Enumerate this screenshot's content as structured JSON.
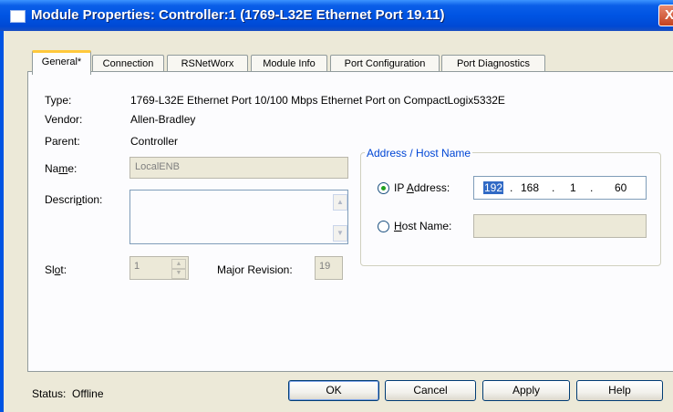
{
  "window": {
    "title": "Module Properties: Controller:1 (1769-L32E Ethernet Port 19.11)",
    "close_glyph": "X"
  },
  "tabs": [
    {
      "label": "General*"
    },
    {
      "label": "Connection"
    },
    {
      "label": "RSNetWorx"
    },
    {
      "label": "Module Info"
    },
    {
      "label": "Port Configuration"
    },
    {
      "label": "Port Diagnostics"
    }
  ],
  "general": {
    "type_label": "Type:",
    "type_value": "1769-L32E Ethernet Port 10/100 Mbps Ethernet Port on CompactLogix5332E",
    "vendor_label": "Vendor:",
    "vendor_value": "Allen-Bradley",
    "parent_label": "Parent:",
    "parent_value": "Controller",
    "name_label_pre": "Na",
    "name_label_ul": "m",
    "name_label_post": "e:",
    "name_value": "LocalENB",
    "description_label_pre": "Descri",
    "description_label_ul": "p",
    "description_label_post": "tion:",
    "description_value": "",
    "slot_label_pre": "Sl",
    "slot_label_ul": "o",
    "slot_label_post": "t:",
    "slot_value": "1",
    "major_revision_label": "Major Revision:",
    "major_revision_value": "19"
  },
  "address": {
    "group_title": "Address / Host Name",
    "ip_label_pre": "IP ",
    "ip_label_ul": "A",
    "ip_label_post": "ddress:",
    "ip_octets": [
      "192",
      "168",
      "1",
      "60"
    ],
    "host_label_pre": "",
    "host_label_ul": "H",
    "host_label_post": "ost Name:",
    "host_value": "",
    "selected": "ip"
  },
  "footer": {
    "status_label": "Status:",
    "status_value": "Offline",
    "ok": "OK",
    "cancel": "Cancel",
    "apply": "Apply",
    "help": "Help"
  },
  "colors": {
    "titlebar": "#0054E3",
    "group_title": "#0046D5",
    "active_tab_highlight": "#FFC83C",
    "selection": "#316AC5"
  }
}
